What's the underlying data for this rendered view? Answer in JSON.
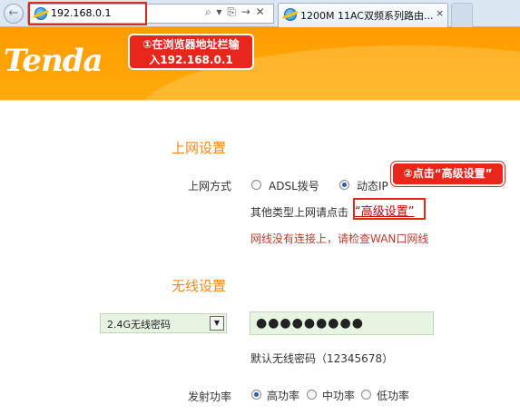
{
  "browser": {
    "address": "192.168.0.1",
    "address_tools": "⌕ ▾ ⎘ → ✕",
    "tab_title": "1200M 11AC双频系列路由...",
    "tab_close": "×",
    "back_glyph": "←"
  },
  "header": {
    "logo": "Tenda",
    "step1_line1": "①在浏览器地址栏输",
    "step1_line2": "入192.168.0.1"
  },
  "internet": {
    "section_title": "上网设置",
    "mode_label": "上网方式",
    "options": [
      {
        "label": "ADSL拨号",
        "selected": false
      },
      {
        "label": "动态IP",
        "selected": true
      }
    ],
    "other_text": "其他类型上网请点击",
    "advanced_link": "“高级设置”",
    "step2_callout": "②点击“高级设置”",
    "warning": "网线没有连接上，请检查WAN口网线"
  },
  "wireless": {
    "section_title": "无线设置",
    "select_value": "2.4G无线密码",
    "select_arrow": "▼",
    "password_value": "●●●●●●●●●",
    "default_hint": "默认无线密码（12345678）",
    "power_label": "发射功率",
    "power_options": [
      {
        "label": "高功率",
        "selected": true
      },
      {
        "label": "中功率",
        "selected": false
      },
      {
        "label": "低功率",
        "selected": false
      }
    ]
  },
  "colors": {
    "header_orange": "#ff9b00",
    "section_orange": "#f08a1c",
    "callout_red": "#e8261b",
    "input_green": "#e6f5e2"
  }
}
